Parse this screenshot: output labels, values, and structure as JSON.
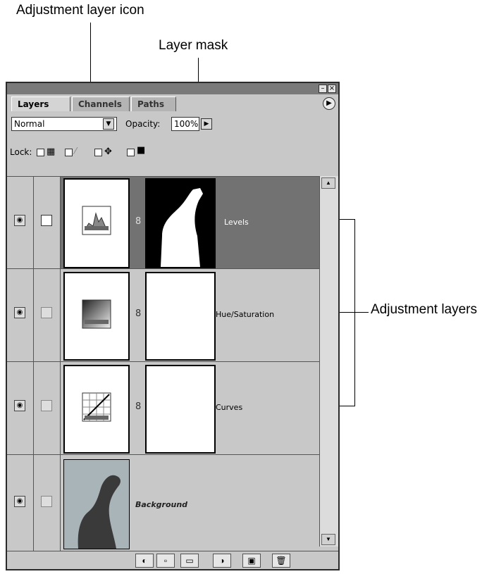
{
  "callouts": {
    "adjustment_layer_icon": "Adjustment layer icon",
    "layer_mask": "Layer mask",
    "adjustment_layers": "Adjustment layers"
  },
  "palette": {
    "tabs": [
      "Layers",
      "Channels",
      "Paths"
    ],
    "active_tab": "Layers",
    "blend_mode": "Normal",
    "opacity_label": "Opacity:",
    "opacity_value": "100%",
    "lock_label": "Lock:",
    "layers": [
      {
        "name": "Levels",
        "selected": true,
        "has_mask": true,
        "mask_type": "silhouette"
      },
      {
        "name": "Hue/Saturation",
        "selected": false,
        "has_mask": true,
        "mask_type": "white"
      },
      {
        "name": "Curves",
        "selected": false,
        "has_mask": true,
        "mask_type": "white"
      },
      {
        "name": "Background",
        "selected": false,
        "has_mask": false
      }
    ],
    "icons": {
      "eye": "eye-icon",
      "link": "link-icon",
      "menu": "palette-menu-icon",
      "bottom": [
        "layer-style-icon",
        "add-mask-icon",
        "new-set-icon",
        "new-adjustment-layer-icon",
        "new-layer-icon",
        "trash-icon"
      ]
    },
    "colors": {
      "selected_row": "#727272",
      "panel": "#c8c8c8"
    }
  }
}
